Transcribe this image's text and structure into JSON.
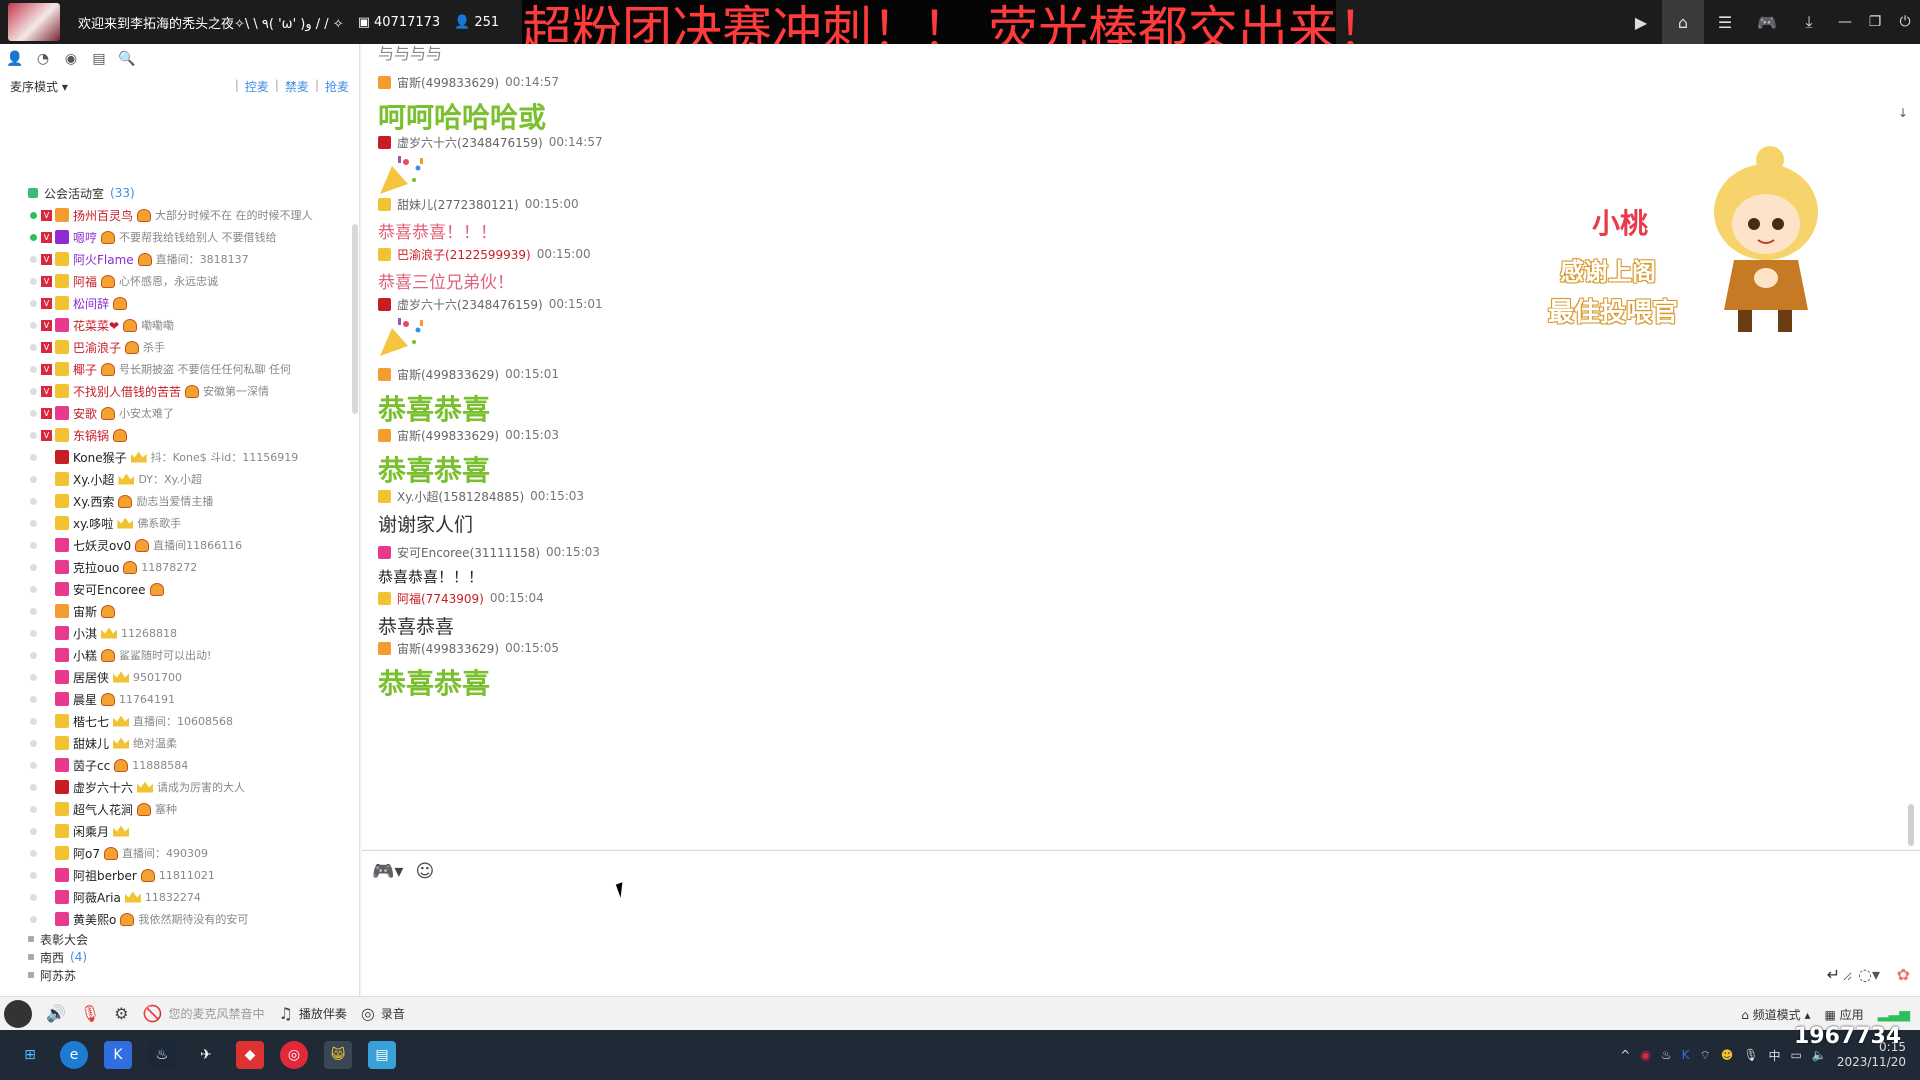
{
  "titlebar": {
    "title": "欢迎来到李拓海的秃头之夜✧\\ \\ ٩( 'ω' )و / / ✧",
    "channel_id": "40717173",
    "online_count": "251"
  },
  "banner": {
    "text": "超粉团决赛冲刺！！ 荧光棒都交出来！"
  },
  "left": {
    "mode_label": "麦序模式",
    "actions": [
      "控麦",
      "禁麦",
      "抢麦"
    ]
  },
  "group": {
    "name": "公会活动室",
    "count": "(33)"
  },
  "members": [
    {
      "name": "扬州百灵鸟",
      "sig": "大部分时候不在 在的时候不理人",
      "online": true,
      "v": true,
      "color": "red",
      "role": "#f39c2f",
      "badge": "medal"
    },
    {
      "name": "嗯哼",
      "sig": "不要帮我给钱给别人 不要借钱给",
      "online": true,
      "v": true,
      "color": "purple",
      "role": "#8e2bd2",
      "badge": "medal"
    },
    {
      "name": "阿火Flame",
      "sig": "直播间：3818137",
      "online": false,
      "v": true,
      "color": "purple",
      "role": "#f1c232",
      "badge": "medal"
    },
    {
      "name": "阿福",
      "sig": "心怀感恩，永远忠诚",
      "online": false,
      "v": true,
      "color": "red",
      "role": "#f1c232",
      "badge": "medal"
    },
    {
      "name": "松间辞",
      "sig": "",
      "online": false,
      "v": true,
      "color": "purple",
      "role": "#f1c232",
      "badge": "medal"
    },
    {
      "name": "花菜菜❤",
      "sig": "嘞嘞嘞",
      "online": false,
      "v": true,
      "color": "red",
      "role": "#e83a8c",
      "badge": "medal"
    },
    {
      "name": "巴渝浪子",
      "sig": "杀手",
      "online": false,
      "v": true,
      "color": "red",
      "role": "#f1c232",
      "badge": "medal"
    },
    {
      "name": "椰子",
      "sig": "号长期披盗 不要信任任何私聊 任何",
      "online": false,
      "v": true,
      "color": "red",
      "role": "#f1c232",
      "badge": "medal"
    },
    {
      "name": "不找别人借钱的苦苦",
      "sig": "安徽第一深情",
      "online": false,
      "v": true,
      "color": "red",
      "role": "#f1c232",
      "badge": "medal"
    },
    {
      "name": "安歌",
      "sig": "小安太难了",
      "online": false,
      "v": true,
      "color": "red",
      "role": "#e83a8c",
      "badge": "medal"
    },
    {
      "name": "东锅锅",
      "sig": "",
      "online": false,
      "v": true,
      "color": "red",
      "role": "#f1c232",
      "badge": "medal"
    },
    {
      "name": "Kone猴子",
      "sig": "抖：Kone$ 斗id：11156919",
      "online": false,
      "v": false,
      "color": "dark",
      "role": "#c81d25",
      "badge": "crown"
    },
    {
      "name": "Xy.小超",
      "sig": "DY：Xy.小超",
      "online": false,
      "v": false,
      "color": "dark",
      "role": "#f1c232",
      "badge": "crown"
    },
    {
      "name": "Xy.西索",
      "sig": "励志当爱情主播",
      "online": false,
      "v": false,
      "color": "dark",
      "role": "#f1c232",
      "badge": "medal"
    },
    {
      "name": "xy.哆啦",
      "sig": "佛系歌手",
      "online": false,
      "v": false,
      "color": "dark",
      "role": "#f1c232",
      "badge": "crown"
    },
    {
      "name": "七妖灵ov0",
      "sig": "直播间11866116",
      "online": false,
      "v": false,
      "color": "dark",
      "role": "#e83a8c",
      "badge": "medal"
    },
    {
      "name": "克拉ouo",
      "sig": "11878272",
      "online": false,
      "v": false,
      "color": "dark",
      "role": "#e83a8c",
      "badge": "medal"
    },
    {
      "name": "安可Encoree",
      "sig": "",
      "online": false,
      "v": false,
      "color": "dark",
      "role": "#e83a8c",
      "badge": "medal"
    },
    {
      "name": "宙斯",
      "sig": "",
      "online": false,
      "v": false,
      "color": "dark",
      "role": "#f39c2f",
      "badge": "medal"
    },
    {
      "name": "小淇",
      "sig": "11268818",
      "online": false,
      "v": false,
      "color": "dark",
      "role": "#e83a8c",
      "badge": "crown"
    },
    {
      "name": "小糕",
      "sig": "鲨鲨随时可以出动!",
      "online": false,
      "v": false,
      "color": "dark",
      "role": "#e83a8c",
      "badge": "medal"
    },
    {
      "name": "居居侠",
      "sig": "9501700",
      "online": false,
      "v": false,
      "color": "dark",
      "role": "#e83a8c",
      "badge": "crown"
    },
    {
      "name": "晨星",
      "sig": "11764191",
      "online": false,
      "v": false,
      "color": "dark",
      "role": "#e83a8c",
      "badge": "medal"
    },
    {
      "name": "楷七七",
      "sig": "直播间：10608568",
      "online": false,
      "v": false,
      "color": "dark",
      "role": "#f1c232",
      "badge": "crown"
    },
    {
      "name": "甜妹儿",
      "sig": "绝对温柔",
      "online": false,
      "v": false,
      "color": "dark",
      "role": "#f1c232",
      "badge": "crown"
    },
    {
      "name": "茵子cc",
      "sig": "11888584",
      "online": false,
      "v": false,
      "color": "dark",
      "role": "#e83a8c",
      "badge": "medal"
    },
    {
      "name": "虚岁六十六",
      "sig": "请成为厉害的大人",
      "online": false,
      "v": false,
      "color": "dark",
      "role": "#c81d25",
      "badge": "crown"
    },
    {
      "name": "超气人花涧",
      "sig": "塞种",
      "online": false,
      "v": false,
      "color": "dark",
      "role": "#f1c232",
      "badge": "medal"
    },
    {
      "name": "闲乘月",
      "sig": "",
      "online": false,
      "v": false,
      "color": "dark",
      "role": "#f1c232",
      "badge": "crown"
    },
    {
      "name": "阿o7",
      "sig": "直播间：490309",
      "online": false,
      "v": false,
      "color": "dark",
      "role": "#f1c232",
      "badge": "medal"
    },
    {
      "name": "阿祖berber",
      "sig": "11811021",
      "online": false,
      "v": false,
      "color": "dark",
      "role": "#e83a8c",
      "badge": "medal"
    },
    {
      "name": "阿薇Aria",
      "sig": "11832274",
      "online": false,
      "v": false,
      "color": "dark",
      "role": "#e83a8c",
      "badge": "crown"
    },
    {
      "name": "黄美熙o",
      "sig": "我依然期待没有的安可",
      "online": false,
      "v": false,
      "color": "dark",
      "role": "#e83a8c",
      "badge": "medal"
    }
  ],
  "subgroups": [
    {
      "name": "表彰大会",
      "count": ""
    },
    {
      "name": "南西",
      "count": "(4)"
    },
    {
      "name": "阿苏苏",
      "count": ""
    }
  ],
  "chat": {
    "cut_top_text": "与与与与",
    "messages": [
      {
        "user": "宙斯(499833629)",
        "time": "00:14:57",
        "text": "呵呵哈哈哈或",
        "style": "green",
        "user_color": "gray",
        "icon": "#f39c2f"
      },
      {
        "user": "虚岁六十六(2348476159)",
        "time": "00:14:57",
        "text": "",
        "style": "popper",
        "user_color": "gray",
        "icon": "#c81d25"
      },
      {
        "user": "甜妹儿(2772380121)",
        "time": "00:15:00",
        "text": "恭喜恭喜！！！",
        "style": "pink",
        "user_color": "gray",
        "icon": "#f1c232"
      },
      {
        "user": "巴渝浪子(2122599939)",
        "time": "00:15:00",
        "text": "恭喜三位兄弟伙！",
        "style": "pink",
        "user_color": "red",
        "icon": "#f1c232"
      },
      {
        "user": "虚岁六十六(2348476159)",
        "time": "00:15:01",
        "text": "",
        "style": "popper",
        "user_color": "gray",
        "icon": "#c81d25"
      },
      {
        "user": "宙斯(499833629)",
        "time": "00:15:01",
        "text": "恭喜恭喜",
        "style": "green",
        "user_color": "gray",
        "icon": "#f39c2f"
      },
      {
        "user": "宙斯(499833629)",
        "time": "00:15:03",
        "text": "恭喜恭喜",
        "style": "green",
        "user_color": "gray",
        "icon": "#f39c2f"
      },
      {
        "user": "Xy.小超(1581284885)",
        "time": "00:15:03",
        "text": "谢谢家人们",
        "style": "brush",
        "user_color": "gray",
        "icon": "#f1c232"
      },
      {
        "user": "安可Encoree(31111158)",
        "time": "00:15:03",
        "text": "恭喜恭喜！！！",
        "style": "dark",
        "user_color": "gray",
        "icon": "#e83a8c"
      },
      {
        "user": "阿福(7743909)",
        "time": "00:15:04",
        "text": "恭喜恭喜",
        "style": "brush",
        "user_color": "red",
        "icon": "#f1c232"
      },
      {
        "user": "宙斯(499833629)",
        "time": "00:15:05",
        "text": "恭喜恭喜",
        "style": "green",
        "user_color": "gray",
        "icon": "#f39c2f"
      }
    ]
  },
  "mascot": {
    "name": "小桃",
    "line1": "感谢上阁",
    "line2": "最佳投喂官"
  },
  "input": {
    "placeholder": ""
  },
  "bottombar": {
    "mute_hint": "您的麦克风禁音中",
    "accompany": "播放伴奏",
    "record": "录音",
    "channel_mode": "频道模式",
    "apps": "应用"
  },
  "overlay_number": "1967734",
  "taskbar": {
    "ime": "中",
    "time": "0:15",
    "date": "2023/11/20"
  }
}
